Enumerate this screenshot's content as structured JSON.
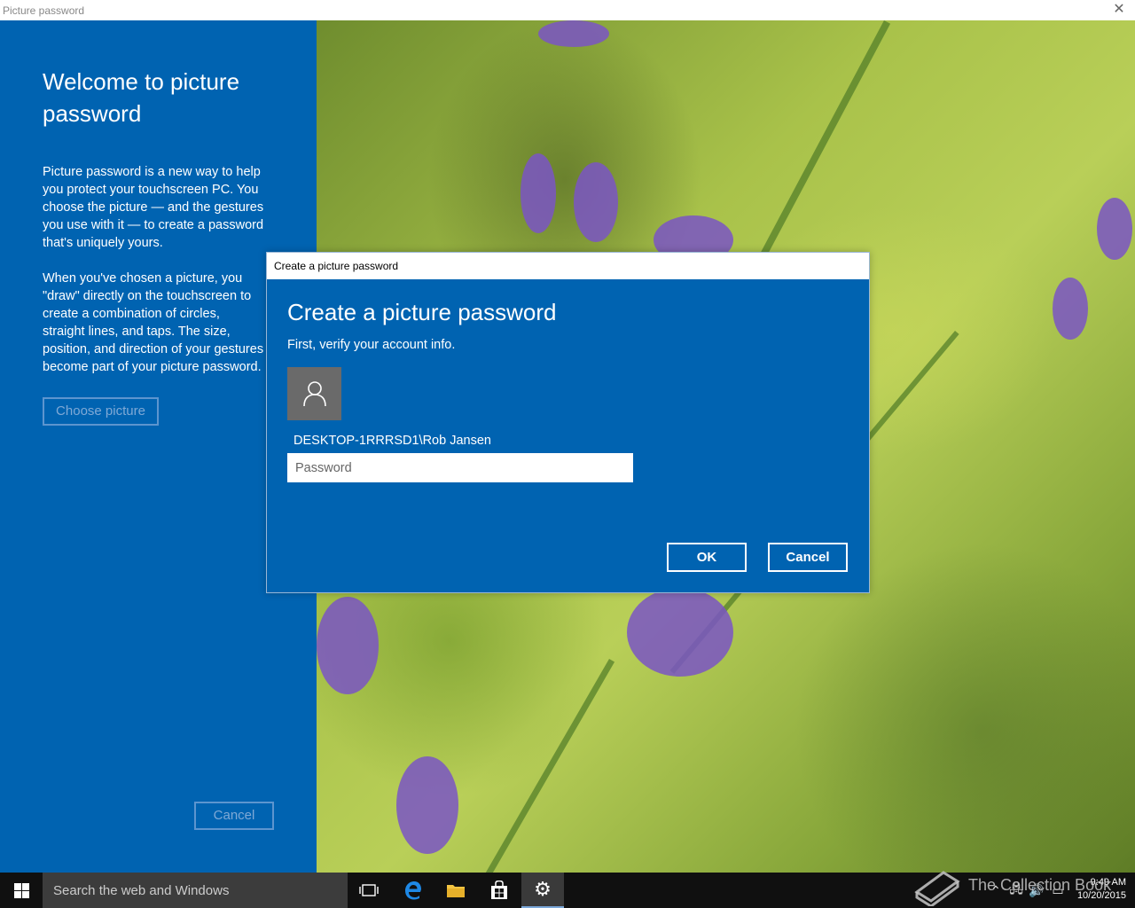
{
  "window": {
    "title": "Picture password"
  },
  "left_panel": {
    "heading": "Welcome to picture password",
    "paragraph1": "Picture password is a new way to help you protect your touchscreen PC. You choose the picture — and the gestures you use with it — to create a password that's uniquely yours.",
    "paragraph2": "When you've chosen a picture, you \"draw\" directly on the touchscreen to create a combination of circles, straight lines, and taps. The size, position, and direction of your gestures become part of your picture password.",
    "choose_picture_label": "Choose picture",
    "cancel_label": "Cancel"
  },
  "dialog": {
    "title": "Create a picture password",
    "heading": "Create a picture password",
    "subtitle": "First, verify your account info.",
    "account_name": "DESKTOP-1RRRSD1\\Rob Jansen",
    "password_placeholder": "Password",
    "password_value": "",
    "ok_label": "OK",
    "cancel_label": "Cancel"
  },
  "taskbar": {
    "search_placeholder": "Search the web and Windows",
    "apps": [
      "task-view",
      "edge",
      "file-explorer",
      "store",
      "settings"
    ],
    "active_app": "settings",
    "time": "9:49 AM",
    "date": "10/20/2015"
  },
  "watermark": {
    "text": "The Collection Book"
  },
  "colors": {
    "accent_blue": "#0063b1",
    "taskbar": "#101010"
  }
}
